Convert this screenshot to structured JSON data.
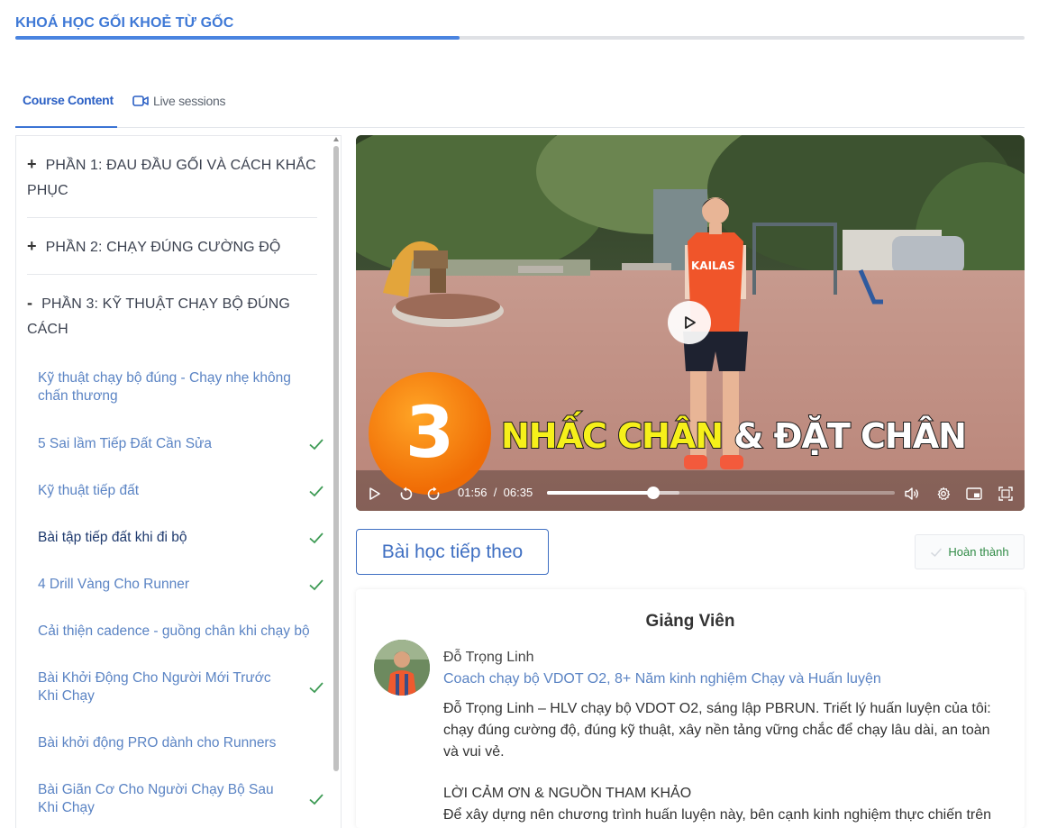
{
  "course": {
    "title": "KHOÁ HỌC GỐI KHOẺ TỪ GỐC",
    "progress_fraction": 0.44
  },
  "tabs": [
    {
      "label": "Course Content",
      "icon": "",
      "active": true
    },
    {
      "label": "Live sessions",
      "icon": "video-camera-icon",
      "active": false
    }
  ],
  "sidebar": {
    "sections": [
      {
        "sign": "+",
        "title": "PHẦN 1: ĐAU ĐẦU GỐI VÀ CÁCH KHẮC PHỤC",
        "expanded": false
      },
      {
        "sign": "+",
        "title": "PHẦN 2: CHẠY ĐÚNG CƯỜNG ĐỘ",
        "expanded": false
      },
      {
        "sign": "-",
        "title": "PHẦN 3: KỸ THUẬT CHẠY BỘ ĐÚNG CÁCH",
        "expanded": true
      }
    ],
    "lessons": [
      {
        "title": "Kỹ thuật chạy bộ đúng - Chạy nhẹ không chấn thương",
        "completed": false,
        "active": false
      },
      {
        "title": "5 Sai lầm Tiếp Đất Cần Sửa",
        "completed": true,
        "active": false
      },
      {
        "title": "Kỹ thuật tiếp đất",
        "completed": true,
        "active": false
      },
      {
        "title": "Bài tập tiếp đất khi đi bộ",
        "completed": true,
        "active": true
      },
      {
        "title": "4 Drill Vàng Cho Runner",
        "completed": true,
        "active": false
      },
      {
        "title": "Cải thiện cadence - guồng chân khi chạy bộ",
        "completed": false,
        "active": false
      },
      {
        "title": "Bài Khởi Động Cho Người Mới Trước Khi Chạy",
        "completed": true,
        "active": false
      },
      {
        "title": "Bài khởi động PRO dành cho Runners",
        "completed": false,
        "active": false
      },
      {
        "title": "Bài Giãn Cơ Cho Người Chạy Bộ Sau Khi Chạy",
        "completed": true,
        "active": false
      }
    ]
  },
  "video": {
    "overlay_number": "3",
    "overlay_caption_part1": "NHẤC CHÂN",
    "overlay_caption_part2": "& ĐẶT CHÂN",
    "shirt_text": "KAILAS",
    "current_time": "01:56",
    "separator": "/",
    "duration": "06:35",
    "played_fraction": 0.305,
    "buffered_fraction": 0.38
  },
  "actions": {
    "next_label": "Bài học tiếp theo",
    "complete_label": "Hoàn thành"
  },
  "instructor": {
    "heading": "Giảng Viên",
    "name": "Đỗ Trọng Linh",
    "role": "Coach chạy bộ VDOT O2, 8+ Năm kinh nghiệm Chạy và Huấn luyện",
    "bio": "Đỗ Trọng Linh – HLV chạy bộ VDOT O2, sáng lập PBRUN. Triết lý huấn luyện của tôi: chạy đúng cường độ, đúng kỹ thuật, xây nền tảng vững chắc để chạy lâu dài, an toàn và vui vẻ.",
    "thanks_title": "LỜI CẢM ƠN & NGUỒN THAM KHẢO",
    "thanks_text": "Để xây dựng nên chương trình huấn luyện này, bên cạnh kinh nghiệm thực chiến trên"
  },
  "colors": {
    "accent": "#3f79d6",
    "lesson_link": "#5b84c4",
    "check_green": "#3e9b55"
  }
}
